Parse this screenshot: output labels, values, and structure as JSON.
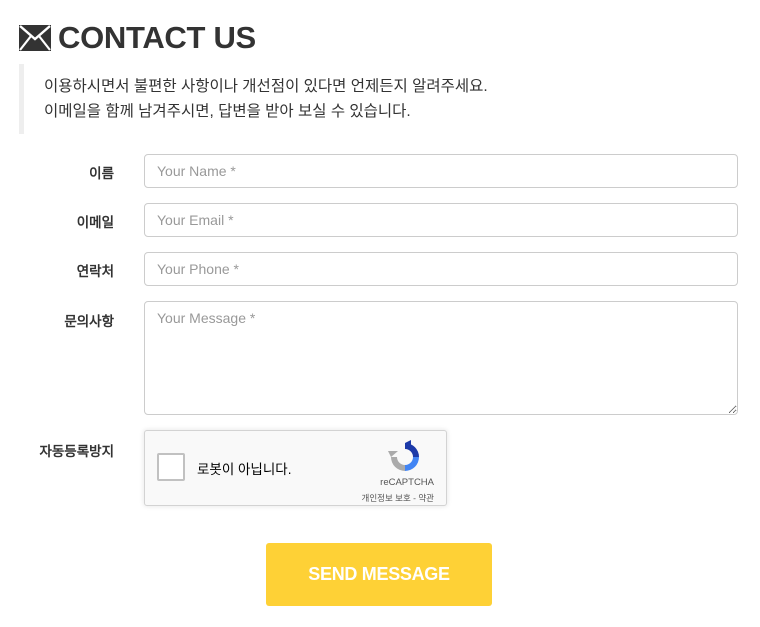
{
  "header": {
    "icon": "envelope-icon",
    "title": "CONTACT US"
  },
  "intro": {
    "line1": "이용하시면서 불편한 사항이나 개선점이 있다면 언제든지 알려주세요.",
    "line2": "이메일을 함께 남겨주시면, 답변을 받아 보실 수 있습니다."
  },
  "form": {
    "name": {
      "label": "이름",
      "placeholder": "Your Name *",
      "value": ""
    },
    "email": {
      "label": "이메일",
      "placeholder": "Your Email *",
      "value": ""
    },
    "phone": {
      "label": "연락처",
      "placeholder": "Your Phone *",
      "value": ""
    },
    "message": {
      "label": "문의사항",
      "placeholder": "Your Message *",
      "value": ""
    },
    "captcha": {
      "label": "자동등록방지",
      "checkbox_label": "로봇이 아닙니다.",
      "brand": "reCAPTCHA",
      "privacy": "개인정보 보호",
      "separator": " - ",
      "terms": "약관",
      "icon": "recaptcha-icon",
      "checked": false
    },
    "submit_label": "SEND MESSAGE"
  },
  "colors": {
    "accent": "#fed136",
    "text": "#333333",
    "placeholder": "#999999",
    "border": "#cccccc",
    "intro_border": "#eeeeee"
  }
}
